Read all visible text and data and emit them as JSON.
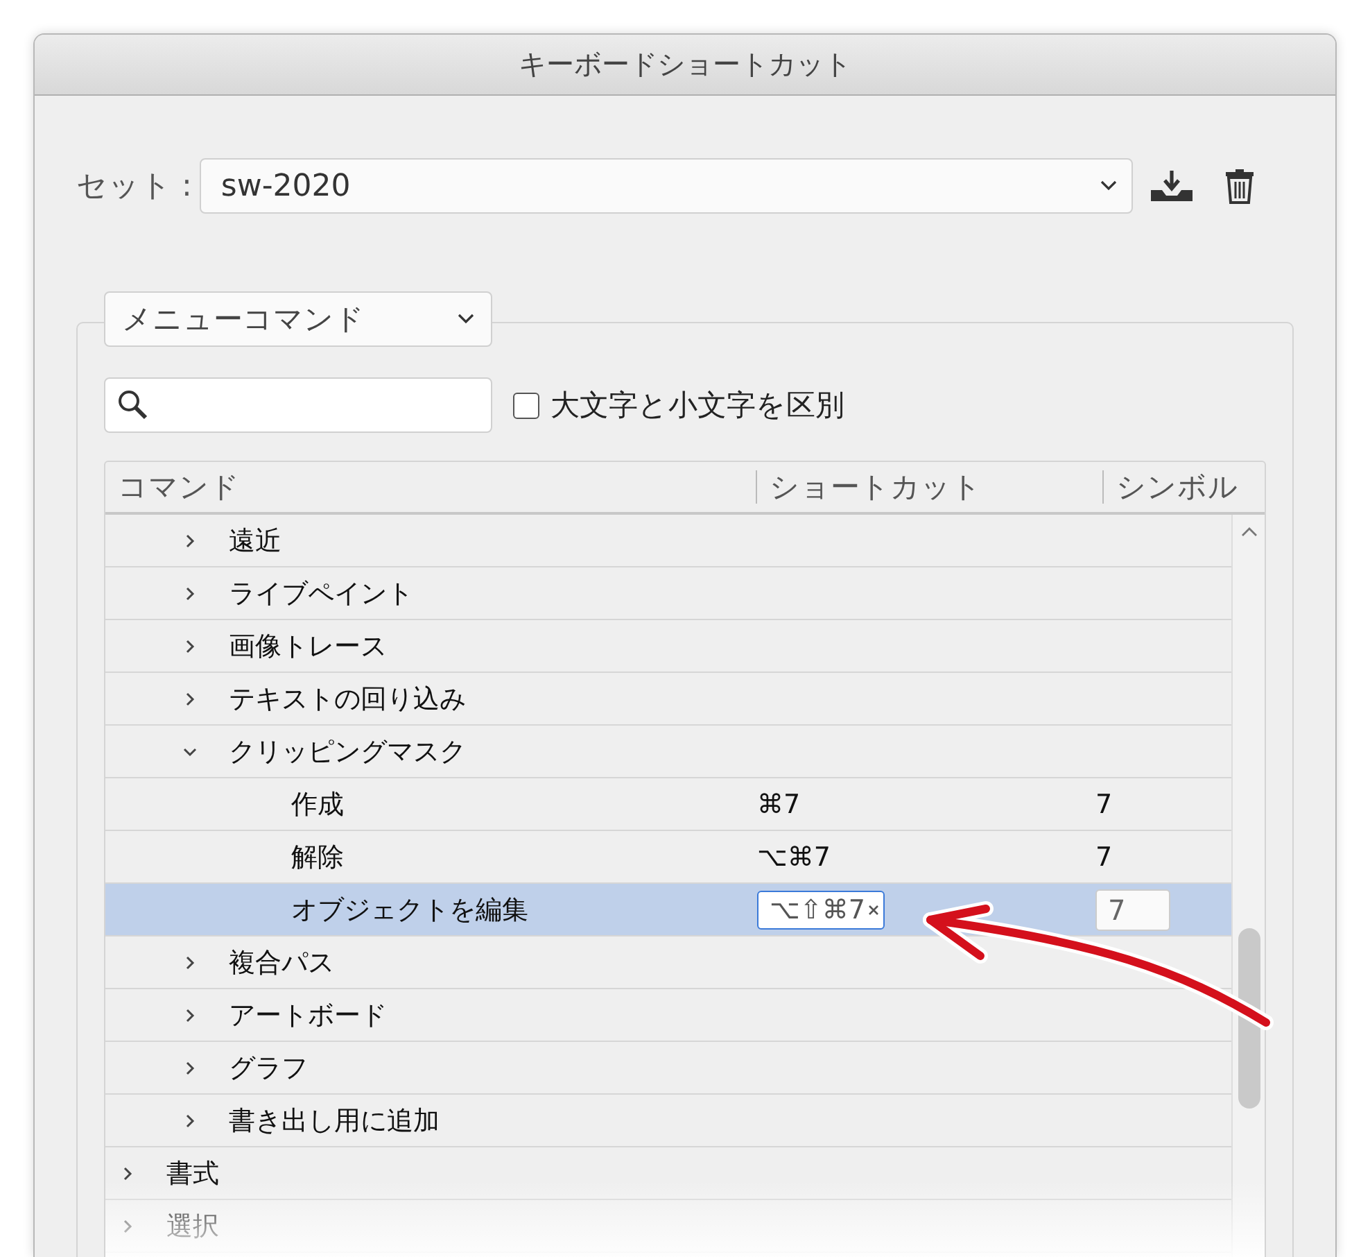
{
  "window": {
    "title": "キーボードショートカット"
  },
  "set": {
    "label": "セット :",
    "value": "sw-2020"
  },
  "category": {
    "value": "メニューコマンド"
  },
  "case_sensitive": {
    "label": "大文字と小文字を区別",
    "checked": false
  },
  "table": {
    "columns": [
      "コマンド",
      "ショートカット",
      "シンボル"
    ],
    "rows": [
      {
        "children": [
          {
            "label": "遠近",
            "expanded": false,
            "selected": false
          },
          {
            "label": "ライブペイント",
            "expanded": false,
            "selected": false
          },
          {
            "label": "画像トレース",
            "expanded": false,
            "selected": false
          },
          {
            "label": "テキストの回り込み",
            "expanded": false,
            "selected": false
          },
          {
            "label": "クリッピングマスク",
            "expanded": true,
            "selected": false,
            "children": [
              {
                "label": "作成",
                "shortcut": "⌘7",
                "symbol": "7",
                "selected": false
              },
              {
                "label": "解除",
                "shortcut": "⌥⌘7",
                "symbol": "7",
                "selected": false
              },
              {
                "label": "オブジェクトを編集",
                "shortcut": "⌥⇧⌘7",
                "symbol": "7",
                "selected": true
              }
            ]
          },
          {
            "label": "複合パス",
            "expanded": false,
            "selected": false
          },
          {
            "label": "アートボード",
            "expanded": false,
            "selected": false
          },
          {
            "label": "グラフ",
            "expanded": false,
            "selected": false
          },
          {
            "label": "書き出し用に追加",
            "expanded": false,
            "selected": false
          }
        ]
      },
      {
        "label": "書式",
        "expanded": false,
        "selected": false
      },
      {
        "label": "選択",
        "expanded": false,
        "selected": false
      }
    ]
  }
}
